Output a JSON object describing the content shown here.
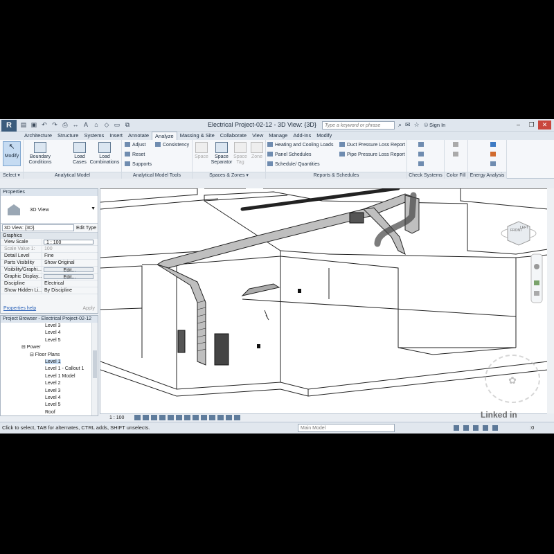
{
  "title_bar": {
    "app_logo": "R",
    "window_title": "Electrical Project-02-12 - 3D View: {3D}",
    "search_placeholder": "Type a keyword or phrase",
    "sign_in": "Sign In",
    "controls": [
      "–",
      "❐",
      "✕"
    ]
  },
  "ribbon_tabs": [
    {
      "label": "Architecture"
    },
    {
      "label": "Structure"
    },
    {
      "label": "Systems"
    },
    {
      "label": "Insert"
    },
    {
      "label": "Annotate"
    },
    {
      "label": "Analyze",
      "active": true
    },
    {
      "label": "Massing & Site"
    },
    {
      "label": "Collaborate"
    },
    {
      "label": "View"
    },
    {
      "label": "Manage"
    },
    {
      "label": "Add-Ins"
    },
    {
      "label": "Modify"
    }
  ],
  "ribbon": {
    "select": {
      "modify": "Modify",
      "title": "Select ▾"
    },
    "analytical_model": {
      "boundary": "Boundary",
      "conditions": "Conditions",
      "load": "Load",
      "cases": "Cases",
      "load2": "Load",
      "combinations": "Combinations",
      "title": "Analytical Model"
    },
    "analytical_tools": {
      "adjust": "Adjust",
      "reset": "Reset",
      "supports": "Supports",
      "consistency": "Consistency",
      "title": "Analytical Model Tools"
    },
    "spaces": {
      "space": "Space",
      "space_sep_1": "Space",
      "space_sep_2": "Separator",
      "space_tag_1": "Space",
      "space_tag_2": "Tag",
      "zone": "Zone",
      "title": "Spaces & Zones ▾"
    },
    "reports": {
      "heating": "Heating and  Cooling Loads",
      "panel": "Panel  Schedules",
      "schedule": "Schedule/  Quantities",
      "duct": "Duct Pressure  Loss Report",
      "pipe": "Pipe Pressure  Loss Report",
      "title": "Reports & Schedules"
    },
    "check_title": "Check Systems",
    "color_title": "Color Fill",
    "energy_title": "Energy Analysis"
  },
  "properties": {
    "header": "Properties",
    "type_name": "3D View",
    "selector": "3D View: {3D}",
    "edit_type": "Edit Type",
    "group": "Graphics",
    "rows": [
      {
        "k": "View Scale",
        "v": "1 : 100"
      },
      {
        "k": "Scale Value  1:",
        "v": "100"
      },
      {
        "k": "Detail Level",
        "v": "Fine"
      },
      {
        "k": "Parts Visibility",
        "v": "Show Original"
      },
      {
        "k": "Visibility/Graphi...",
        "v": "Edit..."
      },
      {
        "k": "Graphic Display...",
        "v": "Edit..."
      },
      {
        "k": "Discipline",
        "v": "Electrical"
      },
      {
        "k": "Show Hidden Li...",
        "v": "By Discipline"
      }
    ],
    "help": "Properties help",
    "apply": "Apply"
  },
  "browser": {
    "header": "Project Browser - Electrical Project-02-12",
    "items": [
      {
        "label": "Level 3",
        "indent": 64
      },
      {
        "label": "Level 4",
        "indent": 64
      },
      {
        "label": "Level 5",
        "indent": 64
      },
      {
        "label": "⊟ Power",
        "indent": 30
      },
      {
        "label": "⊟ Floor Plans",
        "indent": 42
      },
      {
        "label": "Level 1",
        "indent": 64,
        "selected": true
      },
      {
        "label": "Level 1 - Callout 1",
        "indent": 64
      },
      {
        "label": "Level 1 Model",
        "indent": 64
      },
      {
        "label": "Level 2",
        "indent": 64
      },
      {
        "label": "Level 3",
        "indent": 64
      },
      {
        "label": "Level 4",
        "indent": 64
      },
      {
        "label": "Level 5",
        "indent": 64
      },
      {
        "label": "Roof",
        "indent": 64
      }
    ]
  },
  "view_bar": {
    "scale": "1 : 100"
  },
  "status": {
    "message": "Click to select, TAB for alternates, CTRL adds, SHIFT unselects.",
    "model": "Main Model",
    "count": ":0"
  },
  "viewcube": {
    "front": "FRONT",
    "left": "LEFT"
  },
  "watermark": "Linked in"
}
